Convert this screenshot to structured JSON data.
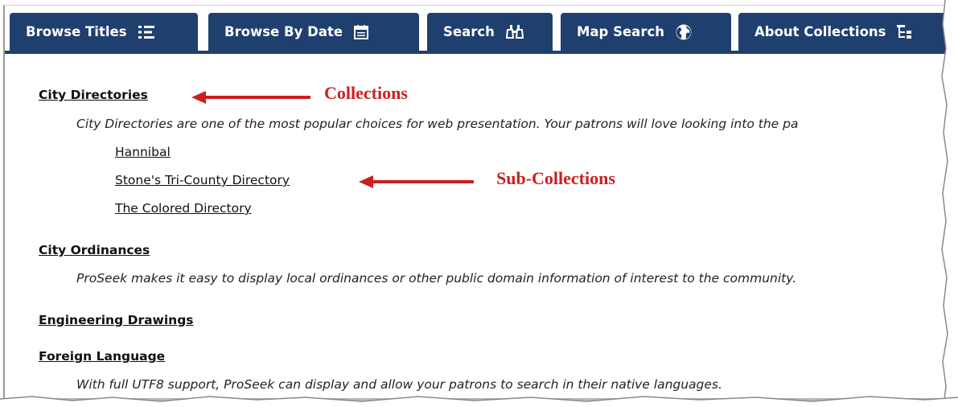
{
  "tabs": [
    {
      "label": "Browse Titles",
      "icon": "list-icon"
    },
    {
      "label": "Browse By Date",
      "icon": "calendar-icon"
    },
    {
      "label": "Search",
      "icon": "binoculars-icon"
    },
    {
      "label": "Map Search",
      "icon": "globe-icon"
    },
    {
      "label": "About Collections",
      "icon": "tree-icon"
    }
  ],
  "collections": [
    {
      "title": "City Directories",
      "description": "City Directories are one of the most popular choices for web presentation. Your patrons will love looking into the pa",
      "subcollections": [
        "Hannibal",
        "Stone's Tri-County Directory",
        "The Colored Directory"
      ]
    },
    {
      "title": "City Ordinances",
      "description": "ProSeek makes it easy to display local ordinances or other public domain information of interest to the community."
    },
    {
      "title": "Engineering Drawings"
    },
    {
      "title": "Foreign Language",
      "description": "With full UTF8 support, ProSeek can display and allow your patrons to search in their native languages."
    }
  ],
  "annotations": {
    "collections": "Collections",
    "subcollections": "Sub-Collections"
  },
  "colors": {
    "tab_bg": "#1f3f6e",
    "annotation": "#cc1f1f"
  }
}
